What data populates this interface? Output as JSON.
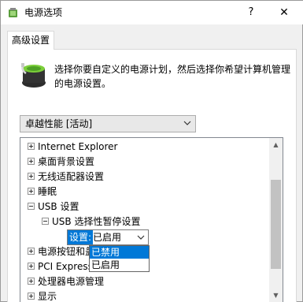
{
  "window": {
    "title": "电源选项",
    "help_label": "?",
    "close_label": "✕"
  },
  "tabs": [
    {
      "label": "高级设置",
      "selected": true
    }
  ],
  "description": "选择你要自定义的电源计划，然后选择你希望计算机管理的电源设置。",
  "plan_select": {
    "value": "卓越性能 [活动]"
  },
  "tree": {
    "items": [
      {
        "label": "Internet Explorer",
        "expander": "+"
      },
      {
        "label": "桌面背景设置",
        "expander": "+"
      },
      {
        "label": "无线适配器设置",
        "expander": "+"
      },
      {
        "label": "睡眠",
        "expander": "+"
      },
      {
        "label": "USB 设置",
        "expander": "-"
      },
      {
        "label": "USB 选择性暂停设置",
        "expander": "-"
      },
      {
        "label": "电源按钮和盖",
        "expander": "+"
      },
      {
        "label": "PCI Express",
        "expander": "+"
      },
      {
        "label": "处理器电源管理",
        "expander": "+"
      },
      {
        "label": "显示",
        "expander": "+"
      }
    ],
    "setting": {
      "label": "设置:",
      "value": "已启用"
    },
    "dropdown_options": [
      {
        "label": "已禁用",
        "highlighted": true
      },
      {
        "label": "已启用",
        "highlighted": false
      }
    ]
  },
  "colors": {
    "accent": "#0078d7"
  }
}
